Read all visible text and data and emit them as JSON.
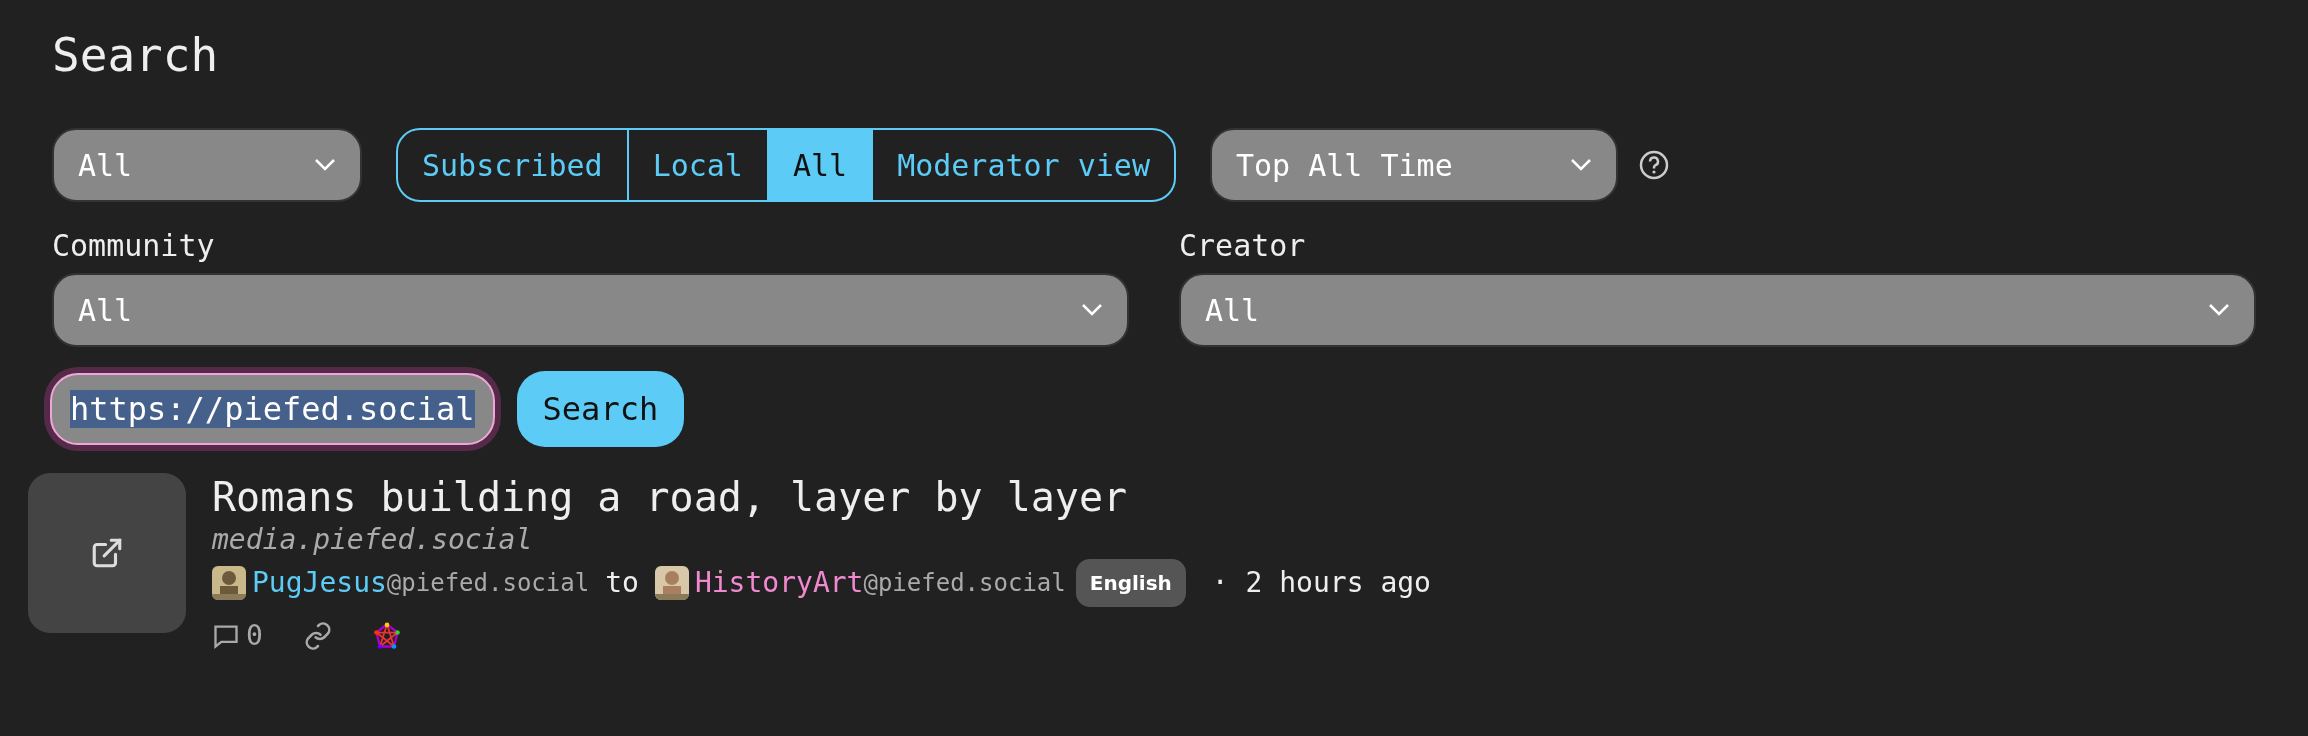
{
  "page_title": "Search",
  "type_select": {
    "value": "All"
  },
  "feed_tabs": [
    {
      "label": "Subscribed",
      "selected": false
    },
    {
      "label": "Local",
      "selected": false
    },
    {
      "label": "All",
      "selected": true
    },
    {
      "label": "Moderator view",
      "selected": false
    }
  ],
  "sort_select": {
    "value": "Top All Time"
  },
  "filters": [
    {
      "label": "Community",
      "value": "All"
    },
    {
      "label": "Creator",
      "value": "All"
    }
  ],
  "search": {
    "value": "https://piefed.social",
    "focused": true,
    "text_selected": true,
    "button": "Search"
  },
  "results": [
    {
      "title": "Romans building a road, layer by layer",
      "domain": "media.piefed.social",
      "author": "PugJesus",
      "author_instance": "@piefed.social",
      "to": "to",
      "community": "HistoryArt",
      "community_instance": "@piefed.social",
      "language": "English",
      "time": "· 2 hours ago",
      "comments": "0"
    }
  ]
}
